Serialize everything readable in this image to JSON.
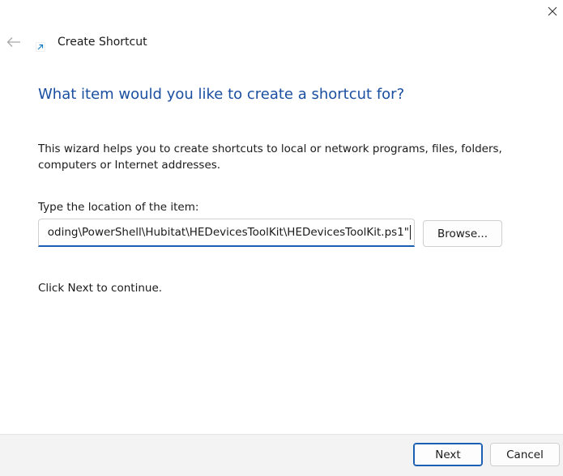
{
  "window": {
    "title": "Create Shortcut",
    "close_icon": "close-icon",
    "back_icon": "back-arrow-icon"
  },
  "content": {
    "heading": "What item would you like to create a shortcut for?",
    "description": "This wizard helps you to create shortcuts to local or network programs, files, folders, computers or Internet addresses.",
    "location_label": "Type the location of the item:",
    "location_value": "oding\\PowerShell\\Hubitat\\HEDevicesToolKit\\HEDevicesToolKit.ps1\"",
    "browse_label": "Browse...",
    "continue_text": "Click Next to continue."
  },
  "footer": {
    "next_label": "Next",
    "cancel_label": "Cancel"
  },
  "colors": {
    "heading": "#1a4fa0",
    "accent": "#1a5fb4",
    "footer_bg": "#f3f3f3"
  }
}
